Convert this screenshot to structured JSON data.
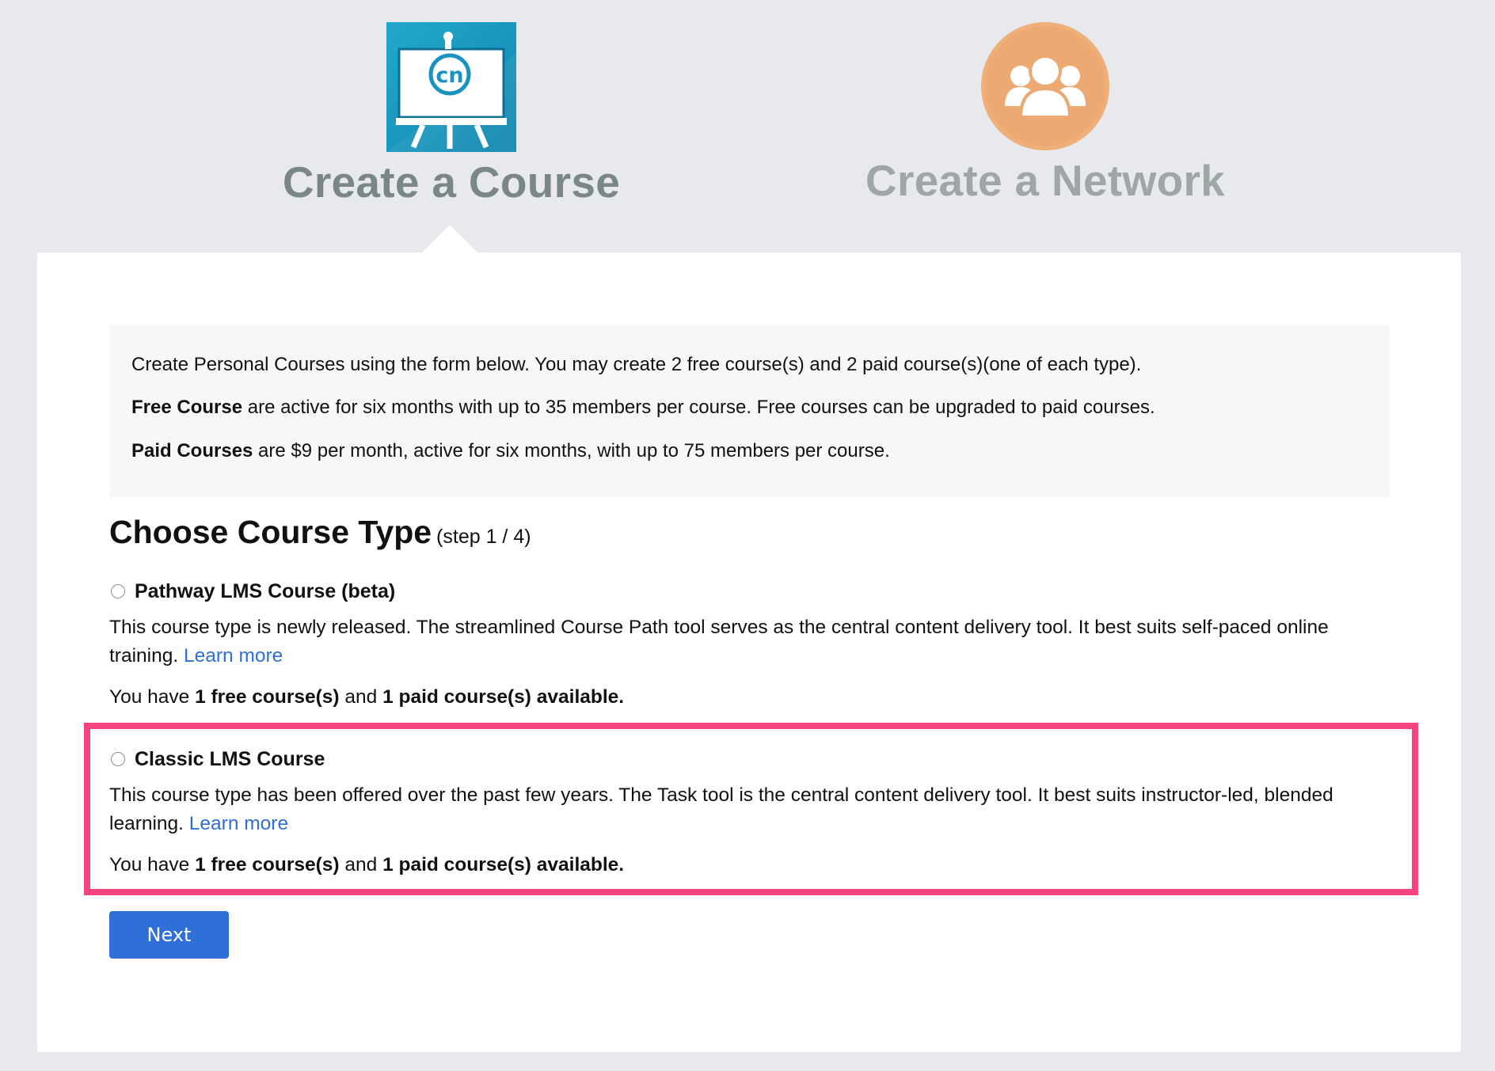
{
  "tabs": {
    "course": {
      "label": "Create a Course",
      "icon": "presentation-board-icon",
      "icon_text": "cn",
      "color": "#1a9cc6"
    },
    "network": {
      "label": "Create a Network",
      "icon": "group-people-icon",
      "color": "#eeaf78"
    }
  },
  "info": {
    "intro": "Create Personal Courses using the form below. You may create 2 free course(s) and 2 paid course(s)(one of each type).",
    "free_label": "Free Course",
    "free_text": " are active for six months with up to 35 members per course. Free courses can be upgraded to paid courses.",
    "paid_label": "Paid Courses",
    "paid_text": " are $9 per month, active for six months, with up to 75 members per course."
  },
  "section": {
    "title": "Choose Course Type",
    "step": "(step 1 / 4)"
  },
  "options": [
    {
      "title": "Pathway LMS Course (beta)",
      "description": "This course type is newly released. The streamlined Course Path tool serves as the central content delivery tool. It best suits self-paced online training.",
      "learn_more": "Learn more",
      "avail_prefix": "You have ",
      "free_count": "1 free course(s)",
      "avail_mid": " and ",
      "paid_count": "1 paid course(s) available.",
      "selected": false
    },
    {
      "title": "Classic LMS Course",
      "description": "This course type has been offered over the past few years. The Task tool is the central content delivery tool. It best suits instructor-led, blended learning.",
      "learn_more": "Learn more",
      "avail_prefix": "You have ",
      "free_count": "1 free course(s)",
      "avail_mid": " and ",
      "paid_count": "1 paid course(s) available.",
      "selected": false
    }
  ],
  "next_label": "Next",
  "colors": {
    "highlight": "#f6457e",
    "button": "#2f6fd8",
    "link": "#2f6fd4"
  }
}
